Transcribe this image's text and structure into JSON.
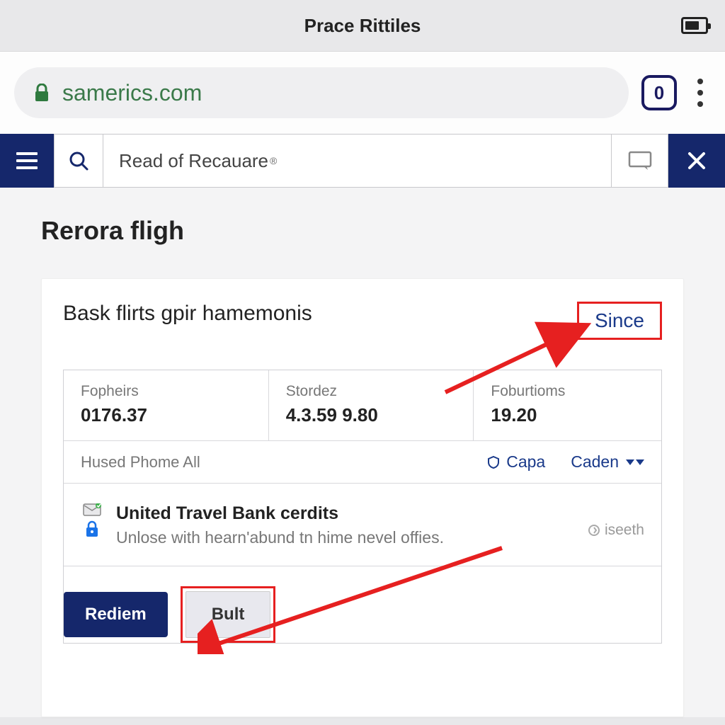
{
  "system": {
    "title": "Prace Rittiles"
  },
  "browser": {
    "url": "samerics.com",
    "tab_count": "0"
  },
  "sitebar": {
    "search_placeholder": "Read of Recauare"
  },
  "page": {
    "title": "Rerora fligh"
  },
  "card": {
    "title": "Bask flirts gpir hamemonis",
    "since_label": "Since",
    "stats": [
      {
        "label": "Fopheirs",
        "value": "0176.37"
      },
      {
        "label": "Stordez",
        "value": "4.3.59 9.80"
      },
      {
        "label": "Foburtioms",
        "value": "19.20"
      }
    ],
    "filter": {
      "left": "Hused Phome  All",
      "badge": "Capa",
      "dropdown": "Caden"
    },
    "credit": {
      "title": "United Travel Bank cerdits",
      "desc": "Unlose with hearn'abund tn hime nevel offies.",
      "right": "iseeth"
    },
    "actions": {
      "redeem": "Rediem",
      "bult": "Bult"
    }
  },
  "colors": {
    "primary": "#15276b",
    "link": "#1a3a8a",
    "highlight": "#e62020"
  }
}
